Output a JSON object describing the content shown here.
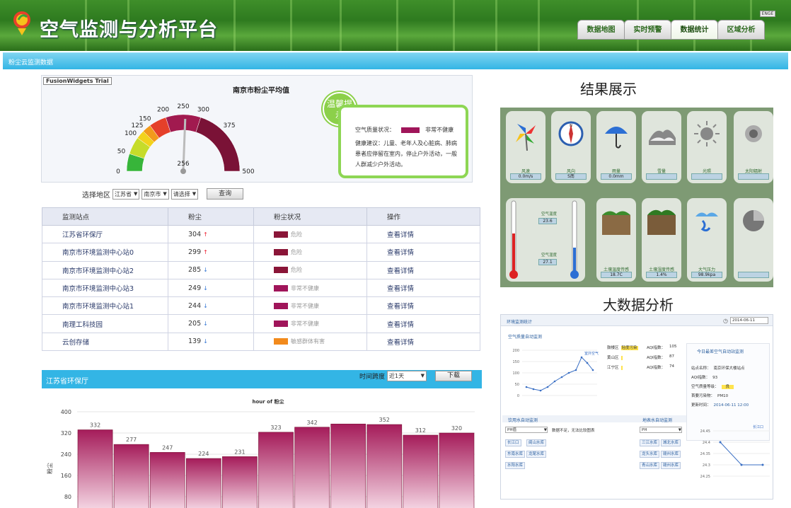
{
  "header": {
    "app_title": "空气监测与分析平台",
    "lang_badge": "ENGE",
    "nav": [
      "数据地图",
      "实时预警",
      "数据统计",
      "区域分析"
    ],
    "active_nav": 2
  },
  "subbar": {
    "label": "粉尘云监测数据"
  },
  "gauge": {
    "trial_label": "FusionWidgets Trial",
    "title": "南京市粉尘平均值",
    "value": 256,
    "value_label": "256",
    "ticks": [
      "0",
      "50",
      "100",
      "125",
      "150",
      "200",
      "250",
      "300",
      "375",
      "500"
    ]
  },
  "tip": {
    "badge": "温馨提示",
    "status_label": "空气质量状况：",
    "status_value": "非常不健康",
    "status_color": "#a0155a",
    "advice": "健康建议：儿童、老年人及心脏病、肺病患者应停留在室内，停止户外活动，一般人群减少户外活动。"
  },
  "region": {
    "label": "选择地区",
    "selects": [
      "江苏省",
      "南京市",
      "请选择"
    ],
    "query_button": "查询"
  },
  "table": {
    "headers": [
      "监测站点",
      "粉尘",
      "粉尘状况",
      "操作"
    ],
    "rows": [
      {
        "station": "江苏省环保厅",
        "value": "304",
        "trend": "up",
        "status": "危险",
        "color": "#8a1538",
        "action": "查看详情"
      },
      {
        "station": "南京市环境监测中心站0",
        "value": "299",
        "trend": "up",
        "status": "危险",
        "color": "#8a1538",
        "action": "查看详情"
      },
      {
        "station": "南京市环境监测中心站2",
        "value": "285",
        "trend": "down",
        "status": "危险",
        "color": "#8a1538",
        "action": "查看详情"
      },
      {
        "station": "南京市环境监测中心站3",
        "value": "249",
        "trend": "down",
        "status": "非常不健康",
        "color": "#a0155a",
        "action": "查看详情"
      },
      {
        "station": "南京市环境监测中心站1",
        "value": "244",
        "trend": "down",
        "status": "非常不健康",
        "color": "#a0155a",
        "action": "查看详情"
      },
      {
        "station": "南理工科技园",
        "value": "205",
        "trend": "down",
        "status": "非常不健康",
        "color": "#a0155a",
        "action": "查看详情"
      },
      {
        "station": "云创存储",
        "value": "139",
        "trend": "down",
        "status": "敏感群体有害",
        "color": "#f28a1c",
        "action": "查看详情"
      }
    ]
  },
  "bar_panel": {
    "title": "江苏省环保厅",
    "time_label": "时间跨度",
    "time_value": "近1天",
    "download_button": "下载"
  },
  "chart_data": {
    "type": "bar",
    "title": "hour of 粉尘",
    "ylabel": "粉尘",
    "ylim": [
      80,
      400
    ],
    "yticks": [
      80,
      160,
      240,
      320,
      400
    ],
    "values": [
      332,
      277,
      247,
      224,
      231,
      323,
      342,
      354,
      352,
      312,
      320
    ],
    "value_labels": [
      "332",
      "277",
      "247",
      "224",
      "231",
      "323",
      "342",
      "",
      "352",
      "312",
      "320"
    ],
    "bar_color": "#a51c5a"
  },
  "right": {
    "result_title": "结果展示",
    "bigdata_title": "大数据分析",
    "tiles_top": [
      {
        "icon": "pinwheel-icon",
        "label": "风速",
        "value": "0.0m/s"
      },
      {
        "icon": "compass-icon",
        "label": "风向",
        "value": "S南"
      },
      {
        "icon": "umbrella-icon",
        "label": "雨量",
        "value": "0.0mm"
      },
      {
        "icon": "snow-icon",
        "label": "雪量",
        "value": ""
      },
      {
        "icon": "sun-icon",
        "label": "光照",
        "value": ""
      },
      {
        "icon": "radiation-icon",
        "label": "太阳辐射",
        "value": ""
      }
    ],
    "tiles_bottom": [
      {
        "icon": "soil-icon",
        "label": "土壤温度传感",
        "value": "18.7C"
      },
      {
        "icon": "soil-moisture-icon",
        "label": "土壤湿度传感",
        "value": "1.4%"
      },
      {
        "icon": "pressure-icon",
        "label": "大气压力",
        "value": "98.9kpa"
      },
      {
        "icon": "disc-icon",
        "label": "",
        "value": ""
      }
    ],
    "thermo": {
      "label1": "空气温度",
      "value1": "23.6",
      "label2": "空气湿度",
      "value2": "27.1"
    }
  },
  "dashboard": {
    "title": "环境监测统计",
    "date": "2014-06-11",
    "section1": "空气质量自动监测",
    "line_legend": "室外空气",
    "stations": [
      {
        "name": "鼓楼区",
        "tag": "轻度污染",
        "aqi_label": "AQI指数：",
        "aqi": "105"
      },
      {
        "name": "黄山区",
        "tag": "",
        "aqi_label": "AQI指数：",
        "aqi": "87"
      },
      {
        "name": "江宁区",
        "tag": "",
        "aqi_label": "AQI指数：",
        "aqi": "74"
      }
    ],
    "today_title": "今日最差空气自动站监测",
    "today_rows": [
      {
        "k": "站点名称：",
        "v": "南京环保大楼站点"
      },
      {
        "k": "AQI指数：",
        "v": "93"
      },
      {
        "k": "空气质量等级：",
        "v": "良"
      },
      {
        "k": "首要污染物：",
        "v": "PM10"
      },
      {
        "k": "更新时间：",
        "v": "2014-06-11 12:00"
      }
    ],
    "water_title": "饮用水自动监测",
    "water_select": "PH值",
    "water_note": "数据不足，无法比较图表",
    "water_tags": [
      "长江口",
      "阆山水库",
      "东南水库",
      "龙尾水库",
      "水阳水库"
    ],
    "water2_title": "地表水自动监测",
    "water2_select": "PH",
    "water2_tags": [
      "三江水库",
      "城北水库",
      "龙头水库",
      "赣州水库",
      "青山水库",
      "赣州水库"
    ],
    "line2_legend": "长江口",
    "line1_y": [
      "200",
      "150",
      "100",
      "50",
      "0"
    ],
    "line2_y": [
      "24.45",
      "24.4",
      "24.35",
      "24.3",
      "24.25"
    ]
  }
}
